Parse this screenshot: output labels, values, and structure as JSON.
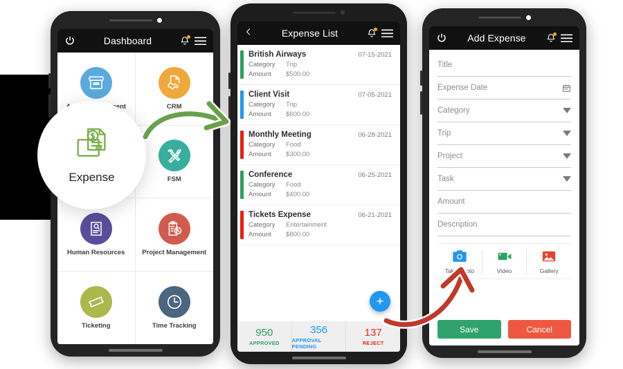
{
  "phone_dashboard": {
    "header": {
      "power_icon": "power-icon",
      "title": "Dashboard",
      "bell_icon": "bell-icon",
      "menu_icon": "hamburger-menu-icon",
      "has_notification_badge": true
    },
    "grid_items": [
      {
        "label": "Asset Management",
        "icon": "archive-box-icon",
        "color": "#5aaade"
      },
      {
        "label": "CRM",
        "icon": "handshake-document-icon",
        "color": "#efa83b"
      },
      {
        "label": "Expense",
        "icon": "wallet-money-icon",
        "color": "#7aaf4a"
      },
      {
        "label": "FSM",
        "icon": "tools-wrench-screwdriver-icon",
        "color": "#3aae9c"
      },
      {
        "label": "Human Resources",
        "icon": "resume-search-icon",
        "color": "#5a4e9c"
      },
      {
        "label": "Project Management",
        "icon": "clipboard-clock-icon",
        "color": "#d15c4e"
      },
      {
        "label": "Ticketing",
        "icon": "ticket-icon",
        "color": "#aab84c"
      },
      {
        "label": "Time Tracking",
        "icon": "clock-icon",
        "color": "#4a6680"
      }
    ],
    "magnifier": {
      "label": "Expense",
      "icon": "wallet-money-icon",
      "accent_color": "#7aaf4a"
    }
  },
  "phone_expense_list": {
    "header": {
      "back_icon": "chevron-left-icon",
      "title": "Expense List",
      "bell_icon": "bell-icon",
      "menu_icon": "hamburger-menu-icon",
      "has_notification_badge": true
    },
    "labels": {
      "category": "Category",
      "amount": "Amount"
    },
    "items": [
      {
        "name": "British Airways",
        "date": "07-15-2021",
        "category": "Trip",
        "amount": "$500.00",
        "accent": "#2ba05f"
      },
      {
        "name": "Client Visit",
        "date": "07-05-2021",
        "category": "Trip",
        "amount": "$600.00",
        "accent": "#2196f3"
      },
      {
        "name": "Monthly Meeting",
        "date": "06-28-2021",
        "category": "Food",
        "amount": "$300.00",
        "accent": "#e8210f"
      },
      {
        "name": "Conference",
        "date": "06-25-2021",
        "category": "Food",
        "amount": "$400.00",
        "accent": "#2ba05f"
      },
      {
        "name": "Tickets Expense",
        "date": "06-21-2021",
        "category": "Entertainment",
        "amount": "$800.00",
        "accent": "#e8210f"
      }
    ],
    "fab": {
      "icon": "plus-icon",
      "label": "+",
      "color": "#2196f3"
    },
    "stats": [
      {
        "number": "950",
        "caption": "APPROVED",
        "color": "#2e9e63"
      },
      {
        "number": "356",
        "caption": "APPROVAL PENDING",
        "color": "#2196f3"
      },
      {
        "number": "137",
        "caption": "REJECT",
        "color": "#e8291a"
      }
    ]
  },
  "phone_add_expense": {
    "header": {
      "power_icon": "power-icon",
      "title": "Add Expense",
      "bell_icon": "bell-icon",
      "menu_icon": "hamburger-menu-icon",
      "has_notification_badge": true
    },
    "fields": [
      {
        "placeholder": "Title",
        "value": "",
        "control": "text"
      },
      {
        "placeholder": "Expense Date",
        "value": "",
        "control": "date",
        "icon": "calendar-icon"
      },
      {
        "placeholder": "Category",
        "value": "",
        "control": "select",
        "icon": "chevron-down-icon"
      },
      {
        "placeholder": "Trip",
        "value": "",
        "control": "select",
        "icon": "chevron-down-icon"
      },
      {
        "placeholder": "Project",
        "value": "",
        "control": "select",
        "icon": "chevron-down-icon"
      },
      {
        "placeholder": "Task",
        "value": "",
        "control": "select",
        "icon": "chevron-down-icon"
      },
      {
        "placeholder": "Amount",
        "value": "",
        "control": "text"
      },
      {
        "placeholder": "Description",
        "value": "",
        "control": "text"
      }
    ],
    "media_buttons": [
      {
        "label": "Take Photo",
        "icon": "camera-icon",
        "color": "#2196f3"
      },
      {
        "label": "Video",
        "icon": "video-camera-icon",
        "color": "#2fa363"
      },
      {
        "label": "Gallery",
        "icon": "image-gallery-icon",
        "color": "#e8442c"
      }
    ],
    "actions": {
      "save_label": "Save",
      "cancel_label": "Cancel",
      "save_color": "#2fa36b",
      "cancel_color": "#ef5840"
    }
  },
  "annotations": {
    "green_arrow": {
      "name": "green-flow-arrow",
      "color": "#6ba04b"
    },
    "red_arrow": {
      "name": "red-flow-arrow",
      "color": "#c0392b"
    }
  }
}
